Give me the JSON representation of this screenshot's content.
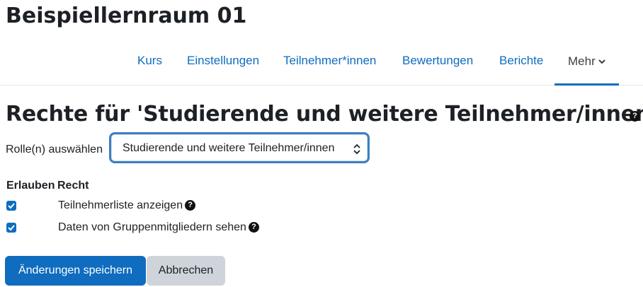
{
  "course": {
    "title": "Beispiellernraum 01"
  },
  "nav": {
    "items": [
      "Kurs",
      "Einstellungen",
      "Teilnehmer*innen",
      "Bewertungen",
      "Berichte"
    ],
    "more_label": "Mehr"
  },
  "page": {
    "heading": "Rechte für 'Studierende und weitere Teilnehmer/innen'"
  },
  "role_select": {
    "label": "Rolle(n) auswählen",
    "selected": "Studierende und weitere Teilnehmer/innen"
  },
  "table": {
    "col_allow": "Erlauben",
    "col_capability": "Recht",
    "rows": [
      {
        "label": "Teilnehmerliste anzeigen",
        "checked": true
      },
      {
        "label": "Daten von Gruppenmitgliedern sehen",
        "checked": true
      }
    ]
  },
  "buttons": {
    "save": "Änderungen speichern",
    "cancel": "Abbrechen"
  },
  "colors": {
    "primary": "#0f6cbf",
    "secondary": "#ced4da",
    "text": "#1d2125"
  }
}
